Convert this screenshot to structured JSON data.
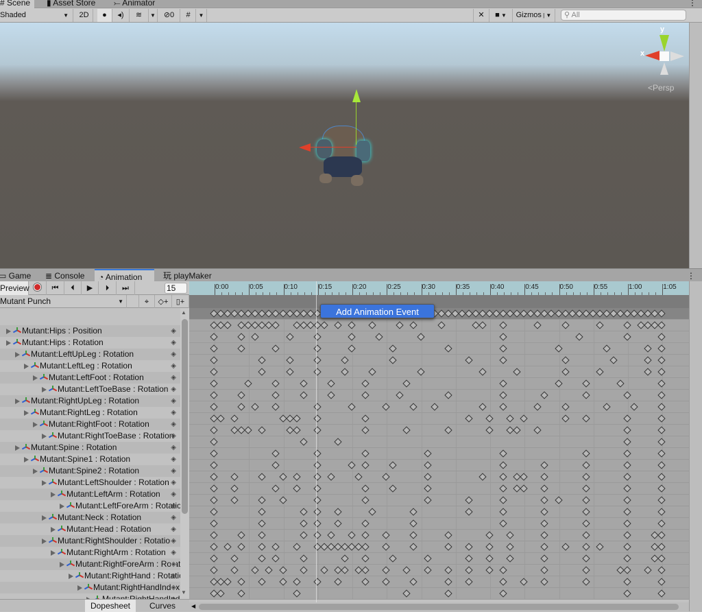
{
  "window_tabs": [
    {
      "label": "Scene",
      "icon": "hash-icon",
      "active": true
    },
    {
      "label": "Asset Store",
      "icon": "bag-icon"
    },
    {
      "label": "Animator",
      "icon": "animator-icon"
    }
  ],
  "scene_toolbar": {
    "shading": "Shaded",
    "mode_2d": "2D",
    "hidden_count": "0",
    "gizmos": "Gizmos",
    "search_placeholder": "All"
  },
  "gizmo": {
    "y_label": "y",
    "x_label": "x",
    "projection": "Persp",
    "colors": {
      "x": "#e0402a",
      "y": "#9ad42c"
    }
  },
  "panel_tabs": [
    {
      "label": "Game",
      "icon": "gamepad-icon"
    },
    {
      "label": "Console",
      "icon": "console-icon"
    },
    {
      "label": "Animation",
      "icon": "clock-icon",
      "active": true
    },
    {
      "label": "playMaker",
      "icon": "playmaker-icon"
    }
  ],
  "animation": {
    "preview": "Preview",
    "frame": "15",
    "clip": "Mutant Punch",
    "accent": "#3b74dc",
    "ruler": [
      "0:00",
      "0:05",
      "0:10",
      "0:15",
      "0:20",
      "0:25",
      "0:30",
      "0:35",
      "0:40",
      "0:45",
      "0:50",
      "0:55",
      "1:00",
      "1:05"
    ],
    "popup": "Add Animation Event",
    "bottom_tabs": [
      "Dopesheet",
      "Curves"
    ],
    "summary_keys": [
      0,
      1,
      2,
      3,
      4,
      5,
      6,
      7,
      8,
      9,
      10,
      11,
      12,
      13,
      14,
      15,
      16,
      17,
      18,
      19,
      20,
      21,
      22,
      23,
      24,
      25,
      26,
      27,
      28,
      29,
      30,
      31,
      32,
      33,
      34,
      35,
      36,
      37,
      38,
      39,
      40,
      41,
      42,
      43,
      44,
      45,
      46,
      47,
      48,
      49,
      50,
      51,
      52,
      53,
      54,
      55,
      56,
      57,
      58,
      59,
      60,
      61,
      62,
      63,
      64,
      65
    ],
    "tracks": [
      {
        "label": "Mutant:Hips : Position",
        "depth": 0,
        "keys": [
          0,
          1,
          2,
          4,
          5,
          6,
          7,
          8,
          9,
          12,
          13,
          14,
          15,
          16,
          18,
          20,
          23,
          27,
          29,
          33,
          38,
          39,
          42,
          47,
          51,
          56,
          60,
          62,
          63,
          64,
          65
        ]
      },
      {
        "label": "Mutant:Hips : Rotation",
        "depth": 0,
        "keys": [
          0,
          4,
          6,
          11,
          15,
          20,
          24,
          30,
          42,
          53,
          60,
          65
        ]
      },
      {
        "label": "Mutant:LeftUpLeg : Rotation",
        "depth": 1,
        "keys": [
          0,
          4,
          9,
          15,
          20,
          26,
          34,
          42,
          50,
          57,
          63,
          65
        ]
      },
      {
        "label": "Mutant:LeftLeg : Rotation",
        "depth": 2,
        "keys": [
          0,
          7,
          11,
          15,
          19,
          26,
          37,
          42,
          51,
          58,
          63,
          65
        ]
      },
      {
        "label": "Mutant:LeftFoot : Rotation",
        "depth": 3,
        "keys": [
          0,
          7,
          11,
          15,
          19,
          23,
          30,
          39,
          44,
          51,
          56,
          63,
          65
        ]
      },
      {
        "label": "Mutant:LeftToeBase : Rotation",
        "depth": 4,
        "keys": [
          0,
          5,
          9,
          13,
          17,
          22,
          28,
          42,
          50,
          54,
          59,
          65
        ]
      },
      {
        "label": "Mutant:RightUpLeg : Rotation",
        "depth": 1,
        "keys": [
          0,
          4,
          9,
          13,
          17,
          22,
          27,
          34,
          42,
          48,
          54,
          60,
          65
        ]
      },
      {
        "label": "Mutant:RightLeg : Rotation",
        "depth": 2,
        "keys": [
          0,
          4,
          6,
          9,
          15,
          20,
          25,
          29,
          32,
          39,
          42,
          47,
          51,
          57,
          61,
          65
        ]
      },
      {
        "label": "Mutant:RightFoot : Rotation",
        "depth": 3,
        "keys": [
          0,
          1,
          3,
          10,
          11,
          12,
          15,
          22,
          37,
          40,
          43,
          45,
          51,
          54,
          60,
          65
        ]
      },
      {
        "label": "Mutant:RightToeBase : Rotation",
        "depth": 4,
        "keys": [
          0,
          3,
          4,
          5,
          7,
          11,
          12,
          15,
          22,
          28,
          34,
          40,
          43,
          44,
          47,
          60,
          65
        ]
      },
      {
        "label": "Mutant:Spine : Rotation",
        "depth": 1,
        "keys": [
          0,
          13,
          18,
          60,
          65
        ]
      },
      {
        "label": "Mutant:Spine1 : Rotation",
        "depth": 2,
        "keys": [
          0,
          9,
          15,
          22,
          31,
          42,
          54,
          60,
          65
        ]
      },
      {
        "label": "Mutant:Spine2 : Rotation",
        "depth": 3,
        "keys": [
          0,
          9,
          15,
          20,
          22,
          26,
          31,
          42,
          48,
          54,
          60,
          65
        ]
      },
      {
        "label": "Mutant:LeftShoulder : Rotation",
        "depth": 4,
        "keys": [
          0,
          3,
          7,
          10,
          12,
          15,
          17,
          21,
          25,
          31,
          39,
          42,
          44,
          45,
          48,
          54,
          60,
          65
        ]
      },
      {
        "label": "Mutant:LeftArm : Rotation",
        "depth": 5,
        "keys": [
          0,
          3,
          9,
          12,
          15,
          22,
          26,
          31,
          42,
          44,
          45,
          48,
          54,
          60,
          65
        ]
      },
      {
        "label": "Mutant:LeftForeArm : Rotation",
        "depth": 6,
        "keys": [
          0,
          3,
          7,
          10,
          15,
          22,
          31,
          37,
          42,
          48,
          50,
          54,
          60,
          65
        ]
      },
      {
        "label": "Mutant:Neck : Rotation",
        "depth": 4,
        "keys": [
          0,
          7,
          13,
          15,
          18,
          23,
          29,
          37,
          42,
          48,
          54,
          60,
          65
        ]
      },
      {
        "label": "Mutant:Head : Rotation",
        "depth": 5,
        "keys": [
          0,
          7,
          13,
          15,
          18,
          22,
          29,
          42,
          48,
          54,
          60,
          65
        ]
      },
      {
        "label": "Mutant:RightShoulder : Rotation",
        "depth": 4,
        "keys": [
          0,
          4,
          7,
          13,
          15,
          17,
          20,
          22,
          25,
          29,
          34,
          40,
          43,
          48,
          54,
          60,
          64,
          65
        ]
      },
      {
        "label": "Mutant:RightArm : Rotation",
        "depth": 5,
        "keys": [
          0,
          2,
          4,
          7,
          9,
          12,
          15,
          16,
          17,
          18,
          19,
          20,
          21,
          22,
          25,
          29,
          34,
          37,
          40,
          43,
          48,
          51,
          54,
          56,
          60,
          64,
          65
        ]
      },
      {
        "label": "Mutant:RightForeArm : Rotation",
        "depth": 6,
        "keys": [
          0,
          3,
          7,
          9,
          13,
          19,
          22,
          26,
          31,
          37,
          40,
          43,
          48,
          54,
          60,
          64,
          65
        ]
      },
      {
        "label": "Mutant:RightHand : Rotation",
        "depth": 7,
        "keys": [
          0,
          3,
          6,
          8,
          10,
          13,
          16,
          18,
          19,
          21,
          22,
          25,
          28,
          31,
          34,
          37,
          40,
          42,
          48,
          54,
          59,
          60,
          63,
          65
        ]
      },
      {
        "label": "Mutant:RightHandIndex",
        "depth": 8,
        "keys": [
          0,
          1,
          2,
          4,
          7,
          10,
          12,
          15,
          18,
          22,
          25,
          29,
          34,
          37,
          42,
          45,
          48,
          54,
          60,
          65
        ]
      },
      {
        "label": "Mutant:RightHandInd",
        "depth": 9,
        "keys": [
          0,
          1,
          4,
          12,
          28,
          34,
          42,
          60,
          65
        ]
      }
    ]
  }
}
